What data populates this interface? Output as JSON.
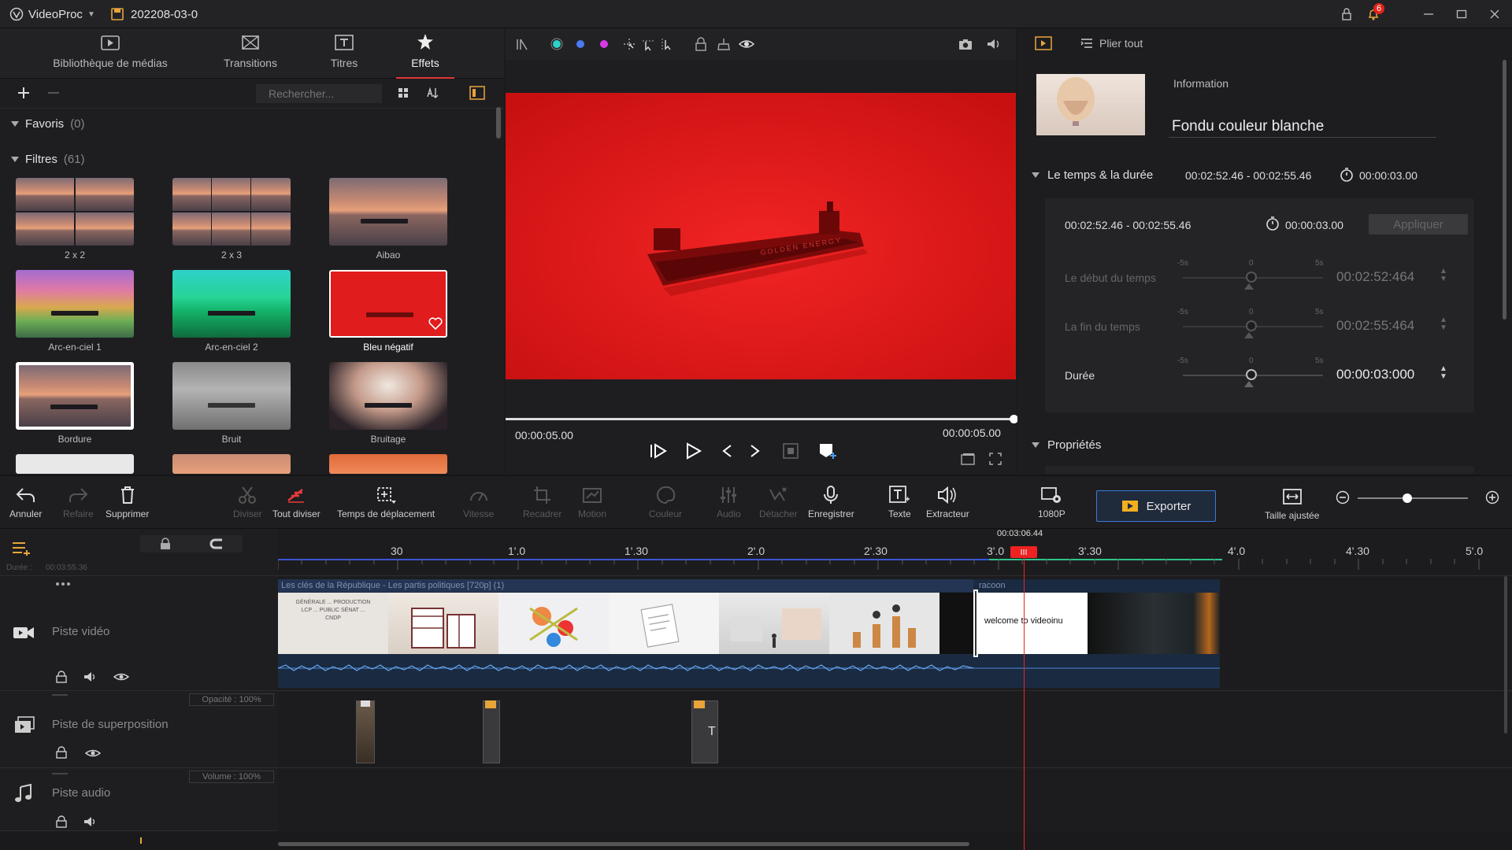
{
  "app": {
    "name": "VideoProc",
    "project": "202208-03-0",
    "notif_count": "6"
  },
  "left": {
    "tabs": [
      {
        "label": "Bibliothèque de médias"
      },
      {
        "label": "Transitions"
      },
      {
        "label": "Titres"
      },
      {
        "label": "Effets"
      }
    ],
    "search_placeholder": "Rechercher...",
    "favorites": {
      "label": "Favoris",
      "count": "(0)"
    },
    "filters": {
      "label": "Filtres",
      "count": "(61)"
    },
    "effects": [
      {
        "label": "2 x 2"
      },
      {
        "label": "2 x 3"
      },
      {
        "label": "Aibao"
      },
      {
        "label": "Arc-en-ciel 1"
      },
      {
        "label": "Arc-en-ciel 2"
      },
      {
        "label": "Bleu négatif"
      },
      {
        "label": "Bordure"
      },
      {
        "label": "Bruit"
      },
      {
        "label": "Bruitage"
      }
    ]
  },
  "preview": {
    "ship_text": "GOLDEN ENERGY",
    "current_time": "00:00:05.00",
    "total_time": "00:00:05.00",
    "progress": 1.0
  },
  "right": {
    "pin_label": "Plier tout",
    "info_label": "Information",
    "effect_name": "Fondu couleur blanche",
    "time_section": {
      "label": "Le temps & la durée",
      "range": "00:02:52.46 - 00:02:55.46",
      "duration": "00:00:03.00"
    },
    "inner": {
      "range": "00:02:52.46 - 00:02:55.46",
      "duration": "00:00:03.00",
      "apply_label": "Appliquer"
    },
    "rows": [
      {
        "label": "Le début du temps",
        "value": "00:02:52:464",
        "min": "-5s",
        "mid": "0",
        "max": "5s"
      },
      {
        "label": "La fin du temps",
        "value": "00:02:55:464",
        "min": "-5s",
        "mid": "0",
        "max": "5s"
      },
      {
        "label": "Durée",
        "value": "00:00:03:000",
        "min": "-5s",
        "mid": "0",
        "max": "5s"
      }
    ],
    "props_label": "Propriétés"
  },
  "toolbar": {
    "undo": "Annuler",
    "redo": "Refaire",
    "delete": "Supprimer",
    "split": "Diviser",
    "split_all": "Tout diviser",
    "move_time": "Temps de déplacement",
    "speed": "Vitesse",
    "crop": "Recadrer",
    "motion": "Motion",
    "color": "Couleur",
    "audio": "Audio",
    "detach": "Détacher",
    "record": "Enregistrer",
    "text": "Texte",
    "extractor": "Extracteur",
    "resolution": "1080P",
    "export": "Exporter",
    "fit": "Taille ajustée"
  },
  "timeline": {
    "playhead_time": "00:03:06.44",
    "duration_label": "Durée :",
    "duration_value": "00:03:55.36",
    "ruler": [
      "30",
      "1'.0",
      "1'.30",
      "2'.0",
      "2'.30",
      "3'.0",
      "3'.30",
      "4'.0",
      "4'.30",
      "5'.0"
    ],
    "video_track": {
      "name": "Piste vidéo",
      "clip_title": "Les clés de la République - Les partis politiques [720p] (1)",
      "clip2_title": "racoon",
      "welcome_text": "welcome to videoinu",
      "thumb_text": "GÉNÉRALE ... PRODUCTION LCP ... PUBLIC SÉNAT ... CNDP"
    },
    "overlay_track": {
      "name": "Piste de superposition",
      "opacity": "Opacité : 100%",
      "text_clip": "T"
    },
    "audio_track": {
      "name": "Piste audio",
      "volume": "Volume : 100%"
    }
  },
  "colors": {
    "accent_red": "#e03434",
    "video_red": "#e11b1b",
    "export_border": "#3b7bd8"
  }
}
